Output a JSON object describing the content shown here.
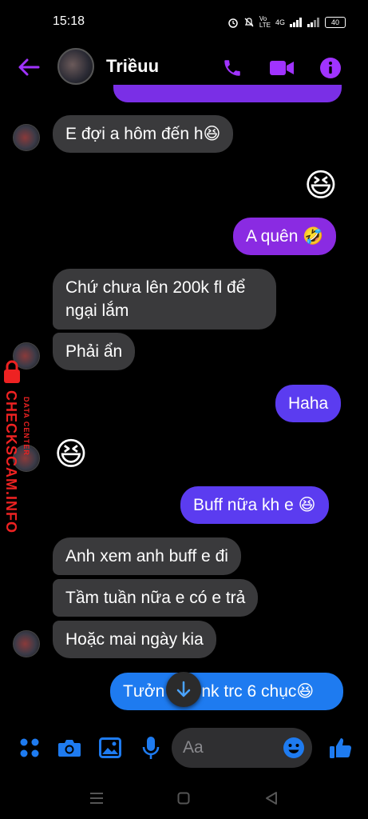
{
  "status_bar": {
    "time": "15:18",
    "network": "4G",
    "battery": "40"
  },
  "header": {
    "contact_name": "Triềuu"
  },
  "messages": [
    {
      "text": "E đợi a hôm đến h",
      "emoji": "😆"
    },
    {
      "emoji": "😆"
    },
    {
      "text": "A quên ",
      "emoji": "🤣"
    },
    {
      "text_line1": "Chứ chưa lên 200k fl để",
      "text_line2": "ngại lắm"
    },
    {
      "text": "Phải ẩn"
    },
    {
      "text": "Haha"
    },
    {
      "emoji": "😆"
    },
    {
      "text": "Buff nữa kh e ",
      "emoji": "😆"
    },
    {
      "text": "Anh xem anh buff e đi"
    },
    {
      "text": "Tầm tuần nữa e có e trả"
    },
    {
      "text": "Hoặc mai ngày kia"
    },
    {
      "text_left": "Tưởn",
      "text_right": "nk trc 6 chục",
      "emoji": "😆"
    }
  ],
  "composer": {
    "placeholder": "Aa"
  },
  "watermark": {
    "text": "CHECKSCAM.INFO",
    "sub": "DATA CENTER"
  },
  "colors": {
    "accent": "#8a2be2",
    "bubble_in": "#3a3a3c",
    "bubble_violet": "#5b3cf0",
    "bubble_blue": "#1e7bf0",
    "composer_icons": "#1e7bf0",
    "header_icons": "#a033ff"
  }
}
